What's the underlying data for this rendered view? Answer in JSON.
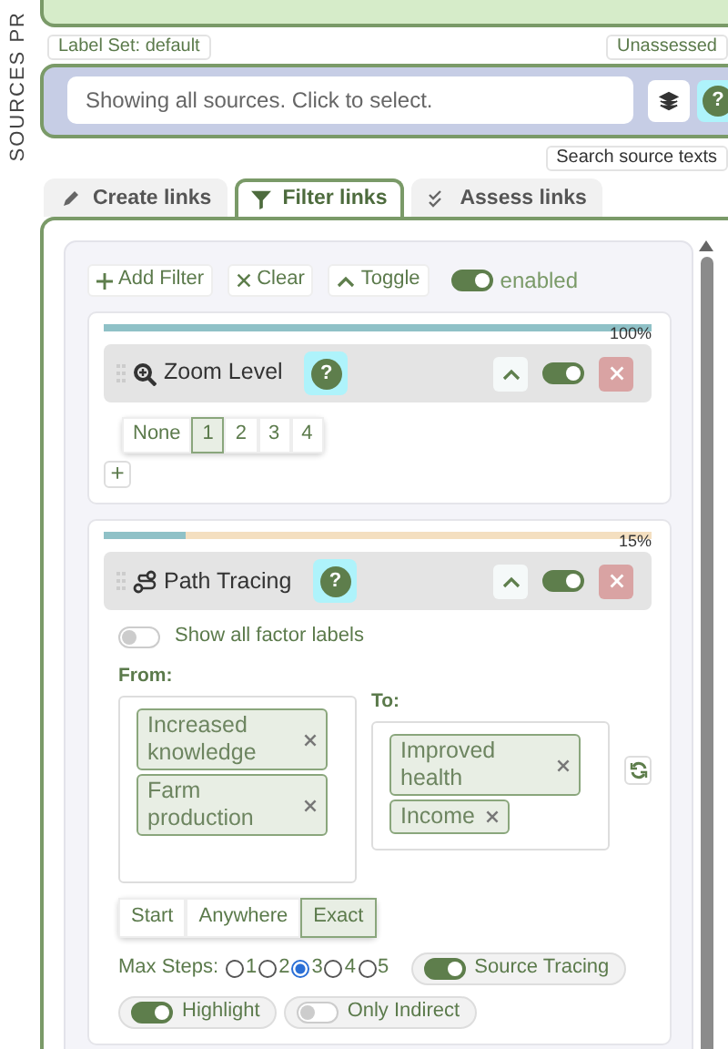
{
  "side_label": "SOURCES PR",
  "label_set": "Label Set: default",
  "assessment_badge": "Unassessed",
  "source_field": {
    "placeholder": "Showing all sources. Click to select.",
    "help": "?"
  },
  "search_link": "Search source texts",
  "tabs": [
    {
      "label": "Create links",
      "selected": false
    },
    {
      "label": "Filter links",
      "selected": true
    },
    {
      "label": "Assess links",
      "selected": false
    }
  ],
  "toolbar": {
    "buttons": [
      "Add Filter",
      "Clear",
      "Toggle"
    ],
    "switch": {
      "label": "enabled",
      "on": true
    }
  },
  "filters": [
    {
      "kind": "zoom",
      "title": "Zoom Level",
      "help": "?",
      "level": 1.0,
      "reading": "100%",
      "on": true,
      "options": [
        {
          "label": "None",
          "selected": false
        },
        {
          "label": "1",
          "selected": true
        },
        {
          "label": "2",
          "selected": false
        },
        {
          "label": "3",
          "selected": false
        },
        {
          "label": "4",
          "selected": false
        }
      ],
      "add": "+"
    },
    {
      "kind": "path",
      "title": "Path Tracing",
      "help": "?",
      "level": 0.15,
      "reading": "15%",
      "on": true,
      "show_labels": {
        "label": "Show all factor labels",
        "on": false
      },
      "from": {
        "label": "From:",
        "tags": [
          "Increased knowledge",
          "Farm production"
        ]
      },
      "to": {
        "label": "To:",
        "tags": [
          "Improved health",
          "Income"
        ]
      },
      "match_modes": [
        {
          "label": "Start",
          "selected": false
        },
        {
          "label": "Anywhere",
          "selected": false
        },
        {
          "label": "Exact",
          "selected": true
        }
      ],
      "max_steps": {
        "label": "Max Steps:",
        "options": [
          {
            "label": "1",
            "selected": false
          },
          {
            "label": "2",
            "selected": false
          },
          {
            "label": "3",
            "selected": true
          },
          {
            "label": "4",
            "selected": false
          },
          {
            "label": "5",
            "selected": false
          }
        ]
      },
      "toggles": [
        {
          "label": "Source Tracing",
          "on": true
        },
        {
          "label": "Highlight",
          "on": true
        },
        {
          "label": "Only Indirect",
          "on": false
        }
      ]
    }
  ]
}
